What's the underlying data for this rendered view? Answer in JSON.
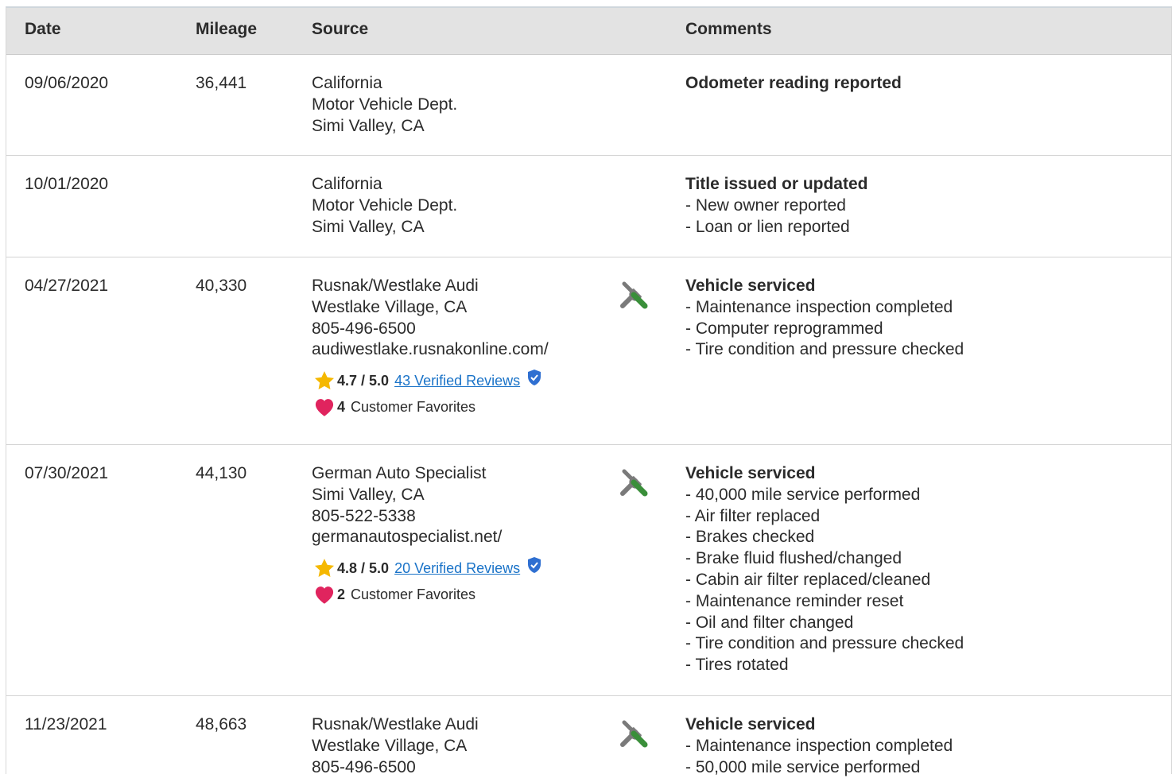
{
  "headers": {
    "date": "Date",
    "mileage": "Mileage",
    "source": "Source",
    "comments": "Comments"
  },
  "rows": [
    {
      "date": "09/06/2020",
      "mileage": "36,441",
      "source": [
        "California",
        "Motor Vehicle Dept.",
        "Simi Valley, CA"
      ],
      "comment_title": "Odometer reading reported",
      "comment_items": []
    },
    {
      "date": "10/01/2020",
      "mileage": "",
      "source": [
        "California",
        "Motor Vehicle Dept.",
        "Simi Valley, CA"
      ],
      "comment_title": "Title issued or updated",
      "comment_items": [
        "- New owner reported",
        "- Loan or lien reported"
      ]
    },
    {
      "date": "04/27/2021",
      "mileage": "40,330",
      "source": [
        "Rusnak/Westlake Audi",
        "Westlake Village, CA",
        "805-496-6500",
        "audiwestlake.rusnakonline.com/"
      ],
      "rating": "4.7 / 5.0",
      "reviews": "43 Verified Reviews",
      "favorites_count": "4",
      "favorites_label": "Customer Favorites",
      "icon": "service-wrench-icon",
      "comment_title": "Vehicle serviced",
      "comment_items": [
        "- Maintenance inspection completed",
        "- Computer reprogrammed",
        "- Tire condition and pressure checked"
      ]
    },
    {
      "date": "07/30/2021",
      "mileage": "44,130",
      "source": [
        "German Auto Specialist",
        "Simi Valley, CA",
        "805-522-5338",
        "germanautospecialist.net/"
      ],
      "rating": "4.8 / 5.0",
      "reviews": "20 Verified Reviews",
      "favorites_count": "2",
      "favorites_label": "Customer Favorites",
      "icon": "service-wrench-icon",
      "comment_title": "Vehicle serviced",
      "comment_items": [
        "- 40,000 mile service performed",
        "- Air filter replaced",
        "- Brakes checked",
        "- Brake fluid flushed/changed",
        "- Cabin air filter replaced/cleaned",
        "- Maintenance reminder reset",
        "- Oil and filter changed",
        "- Tire condition and pressure checked",
        "- Tires rotated"
      ]
    },
    {
      "date": "11/23/2021",
      "mileage": "48,663",
      "source": [
        "Rusnak/Westlake Audi",
        "Westlake Village, CA",
        "805-496-6500"
      ],
      "icon": "service-wrench-icon",
      "comment_title": "Vehicle serviced",
      "comment_items": [
        "- Maintenance inspection completed",
        "- 50,000 mile service performed"
      ]
    }
  ],
  "colors": {
    "header_bg": "#e3e3e3",
    "link": "#1a73c8",
    "star": "#f5b800",
    "heart": "#e0245e",
    "wrench_gray": "#7a7a7a",
    "wrench_green": "#3a8f3a",
    "verified": "#2f6fd1"
  }
}
